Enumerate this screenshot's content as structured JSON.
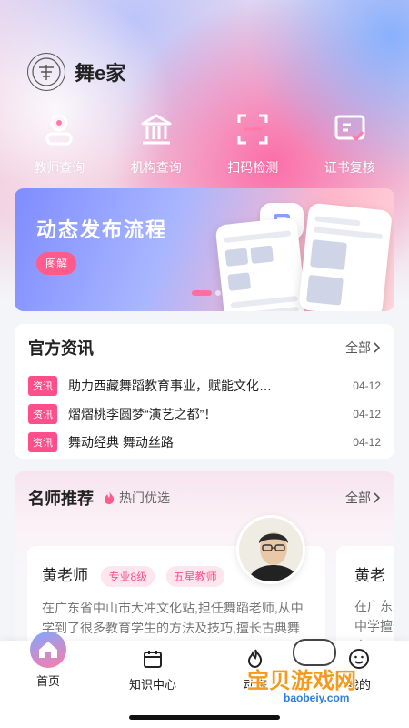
{
  "app": {
    "name": "舞e家",
    "logo_text": "舞"
  },
  "quick_actions": [
    {
      "label": "教师查询",
      "icon": "teacher-icon"
    },
    {
      "label": "机构查询",
      "icon": "institution-icon"
    },
    {
      "label": "扫码检测",
      "icon": "scan-icon"
    },
    {
      "label": "证书复核",
      "icon": "certificate-icon"
    }
  ],
  "banner": {
    "title": "动态发布流程",
    "button": "图解",
    "page_index": 1,
    "page_count": 3
  },
  "news": {
    "title": "官方资讯",
    "more": "全部",
    "items": [
      {
        "tag": "资讯",
        "text": "助力西藏舞蹈教育事业，赋能文化…",
        "date": "04-12"
      },
      {
        "tag": "资讯",
        "text": "熠熠桃李圆梦“演艺之都”！",
        "date": "04-12"
      },
      {
        "tag": "资讯",
        "text": "舞动经典 舞动丝路",
        "date": "04-12"
      }
    ]
  },
  "teachers": {
    "title": "名师推荐",
    "hot_label": "热门优选",
    "more": "全部",
    "cards": [
      {
        "name": "黄老师",
        "badges": [
          "专业8级",
          "五星教师"
        ],
        "desc": "在广东省中山市大冲文化站,担任舞蹈老师,从中学到了很多教育学生的方法及技巧,擅长古典舞"
      },
      {
        "name": "黄老",
        "desc": "在广东从中学擅长古"
      }
    ]
  },
  "tabbar": [
    {
      "label": "首页",
      "icon": "home-icon"
    },
    {
      "label": "知识中心",
      "icon": "calendar-icon"
    },
    {
      "label": "动态",
      "icon": "fire-icon"
    },
    {
      "label": "我的",
      "icon": "smile-icon"
    }
  ],
  "watermark": {
    "text": "宝贝游戏网",
    "url": "baobeiy.com"
  },
  "colors": {
    "accent": "#ff4f8b",
    "banner_start": "#7f8cff",
    "banner_end": "#ffd6dc"
  }
}
